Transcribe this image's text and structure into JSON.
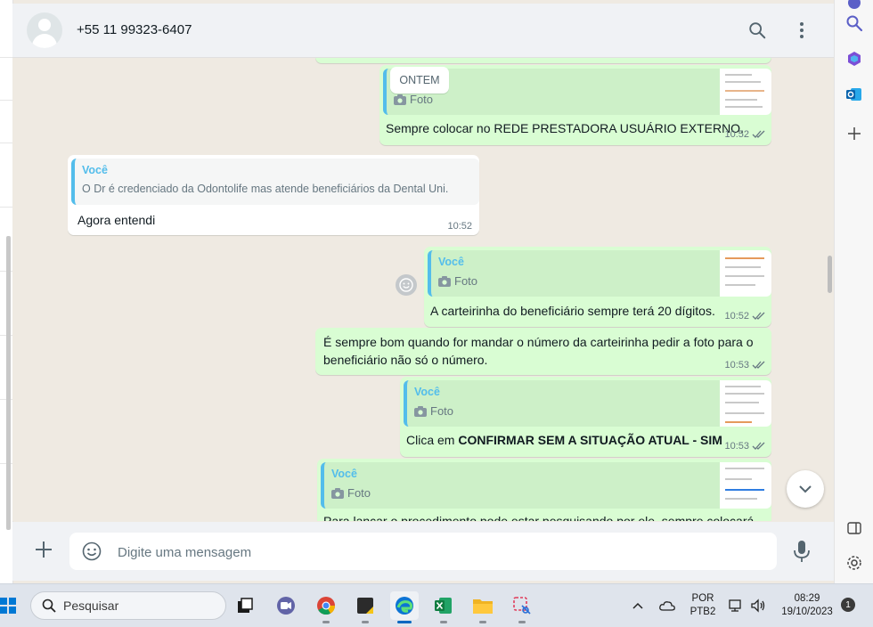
{
  "contact": {
    "phone": "+55 11 99323-6407"
  },
  "chat": {
    "date_chip": "ONTEM",
    "messages": [
      {
        "dir": "out",
        "quote_photo": "Foto",
        "text": "Sempre colocar no REDE PRESTADORA USUÁRIO EXTERNO.",
        "time": "10:52"
      },
      {
        "dir": "in",
        "quote_author": "Você",
        "quote_text": "O Dr é credenciado da Odontolife mas atende beneficiários da Dental Uni.",
        "text": "Agora entendi",
        "time": "10:52"
      },
      {
        "dir": "out",
        "quote_author": "Você",
        "quote_photo": "Foto",
        "text": "A carteirinha do beneficiário sempre terá 20 dígitos.",
        "time": "10:52"
      },
      {
        "dir": "out",
        "text_line1": "É sempre bom quando for mandar o número da carteirinha pedir a foto para o",
        "text_line2": "beneficiário não só o número.",
        "time": "10:53"
      },
      {
        "dir": "out",
        "quote_author": "Você",
        "quote_photo": "Foto",
        "text_prefix": "Clica em ",
        "text_bold": "CONFIRMAR SEM A SITUAÇÃO ATUAL - SIM",
        "time": "10:53"
      },
      {
        "dir": "out",
        "quote_author": "Você",
        "quote_photo": "Foto",
        "text": "Para lançar o procedimento pode estar pesquisando por ele, sempre colocará"
      }
    ]
  },
  "composer": {
    "placeholder": "Digite uma mensagem"
  },
  "taskbar": {
    "search_label": "Pesquisar",
    "lang_line1": "POR",
    "lang_line2": "PTB2",
    "time": "08:29",
    "date": "19/10/2023",
    "notification_count": "1"
  },
  "colors": {
    "outgoing": "#d9fdd3",
    "incoming": "#ffffff",
    "quote_accent": "#53bdeb",
    "read_ticks": "#667781"
  }
}
